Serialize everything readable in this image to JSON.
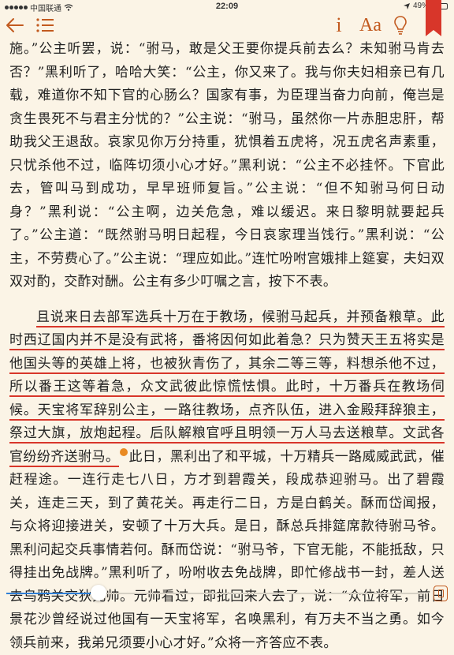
{
  "status": {
    "carrier": "中国联通",
    "time": "22:09",
    "battery_text": "49%",
    "battery_level": 0.49
  },
  "toolbar": {
    "info_label": "i",
    "font_label": "Aa"
  },
  "content": {
    "p1": "施。”公主听罢，说：“驸马，敢是父王要你提兵前去么？未知驸马肯去否？”黑利听了，哈哈大笑：“公主，你又来了。我与你夫妇相亲已有几载，难道你不知下官的心肠么？国家有事，为臣理当奋力向前，俺岂是贪生畏死不与君主分忧的？”公主说：“驸马，虽然你一片赤胆忠肝，帮助我父王退敌。哀家见你万分持重，犹惧着五虎将，况五虎名声素重，只忧杀他不过，临阵切须小心才好。”黑利说：“公主不必挂怀。下官此去，管叫马到成功，早早班师复旨。”公主说：“但不知驸马何日动身？”黑利说：“公主啊，边关危急，难以缓迟。来日黎明就要起兵了。”公主道：“既然驸马明日起程，今日哀家理当饯行。”黑利说：“公主，不劳费心了。”公主说：“理应如此。”连忙吩咐宫娥排上筵宴，夫妇双双对酌，交酢对酬。公主有多少叮嘱之言，按下不表。",
    "p2_hl": "且说来日去部军选兵十万在于教场，候驸马起兵，并预备粮草。此时西辽国内并不是没有武将，番将因何如此着急？只为赞天王五将实是他国头等的英雄上将，也被狄青伤了，其余二等三等，料想杀他不过，所以番王这等着急，众文武彼此惊慌怯惧。此时，十万番兵在教场伺候。天宝将军辞别公主，一路往教场，点齐队伍，进入金殿拜辞狼主，祭过大旗，放炮起程。后队解粮官呼且明领一万人马去送粮草。文武各官纷纷齐送驸马。",
    "p2_rest": "此日，黑利出了和平城，十万精兵一路威威武武，催赶程途。一连行走七八日，方才到碧霞关，段成恭迎驸马。出了碧霞关，连走三天，到了黄花关。再走行二日，方是白鹤关。酥而岱闻报，与众将迎接进关，安顿了十万大兵。是日，酥总兵排筵席款待驸马爷。黑利问起交兵事情若何。酥而岱说：“驸马爷，下官无能，不能抵敌，只得挂出免战牌。”黑利听了，吩咐收去免战牌，即忙修战书一封，差人送去乌鸦关交狄元帅。元帅看过，即批回来人去了，说：“众位将军，前日景花沙曾经说过他国有一天宝将军，名唤黑利，有万夫不当之勇。如今领兵前来，我弟兄须要小心才好。”众将一齐答应不表。"
  },
  "reading_progress": 0.22,
  "colors": {
    "accent": "#c25a1f",
    "underline": "#d8362a",
    "progress": "#2f7fd6",
    "background": "#fbf4e6"
  },
  "icons": [
    "back-arrow-icon",
    "list-menu-icon",
    "info-icon",
    "font-size-icon",
    "bulb-icon",
    "bookmark-icon",
    "note-marker-icon",
    "orientation-lock-icon"
  ]
}
